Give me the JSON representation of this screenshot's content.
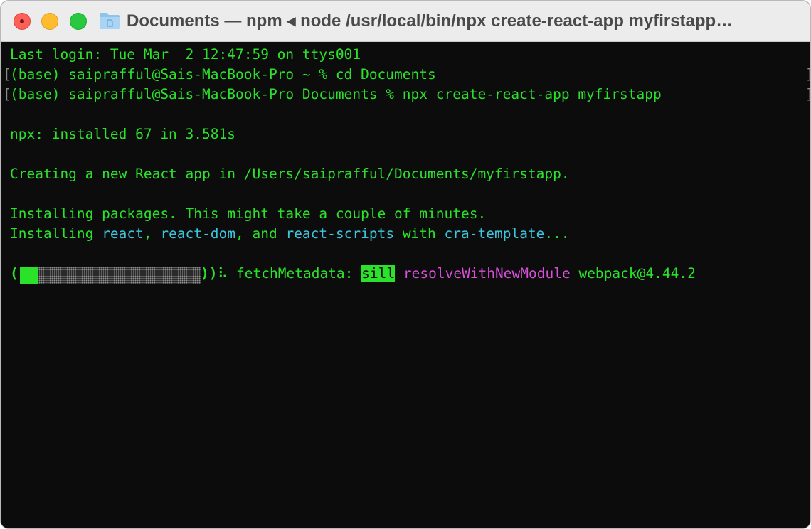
{
  "window": {
    "title": "Documents — npm ◂ node /usr/local/bin/npx create-react-app myfirstapp…"
  },
  "icons": {
    "folder": "folder-icon"
  },
  "terminal": {
    "lines": [
      "Last login: Tue Mar  2 12:47:59 on ttys001",
      "(base) saiprafful@Sais-MacBook-Pro ~ % cd Documents",
      "(base) saiprafful@Sais-MacBook-Pro Documents % npx create-react-app myfirstapp",
      "npx: installed 67 in 3.581s",
      "Creating a new React app in /Users/saiprafful/Documents/myfirstapp.",
      "Installing packages. This might take a couple of minutes."
    ],
    "installing": {
      "prefix": "Installing ",
      "react": "react",
      "sep1": ", ",
      "react_dom": "react-dom",
      "sep2": ", and ",
      "react_scripts": "react-scripts",
      "with": " with ",
      "template": "cra-template",
      "ellipsis": "..."
    },
    "progress": {
      "fraction": 0.1,
      "spinner": "⠧",
      "label": "fetchMetadata:",
      "level": "sill",
      "action": "resolveWithNewModule",
      "package": "webpack@4.44.2"
    }
  },
  "colors": {
    "text": "#2be22b",
    "cyan": "#3cc5dc",
    "magenta": "#d94fd9",
    "background": "#0c0c0c"
  }
}
